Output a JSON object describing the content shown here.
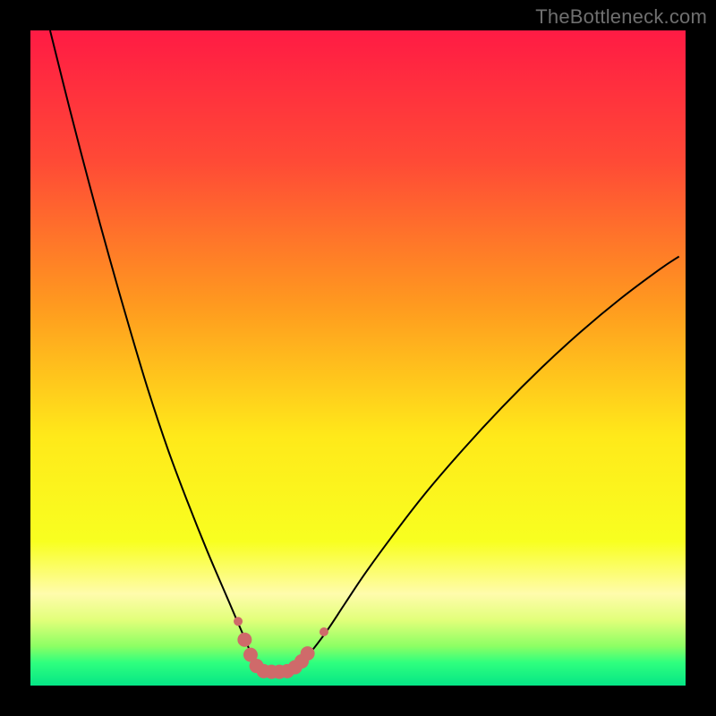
{
  "watermark": "TheBottleneck.com",
  "chart_data": {
    "type": "line",
    "title": "",
    "xlabel": "",
    "ylabel": "",
    "xlim": [
      0,
      100
    ],
    "ylim": [
      0,
      100
    ],
    "background_gradient": {
      "stops": [
        {
          "pos": 0.0,
          "color": "#ff1b44"
        },
        {
          "pos": 0.2,
          "color": "#ff4a36"
        },
        {
          "pos": 0.42,
          "color": "#ff9a1f"
        },
        {
          "pos": 0.62,
          "color": "#ffe91a"
        },
        {
          "pos": 0.78,
          "color": "#f8ff20"
        },
        {
          "pos": 0.86,
          "color": "#fffcac"
        },
        {
          "pos": 0.9,
          "color": "#e2ff7a"
        },
        {
          "pos": 0.94,
          "color": "#8cff64"
        },
        {
          "pos": 0.965,
          "color": "#2fff7e"
        },
        {
          "pos": 1.0,
          "color": "#05e686"
        }
      ]
    },
    "series": [
      {
        "name": "bottleneck-curve",
        "color": "#000000",
        "width": 2,
        "x": [
          3,
          6,
          9,
          12,
          15,
          18,
          21,
          24,
          27,
          30,
          31.5,
          33,
          34,
          34.8,
          36,
          38,
          40,
          42,
          45,
          48,
          51,
          55,
          60,
          66,
          72,
          78,
          84,
          90,
          96,
          99
        ],
        "y": [
          100,
          88,
          76.5,
          65.5,
          55,
          45,
          36,
          28,
          20.5,
          13.5,
          10,
          6.5,
          4,
          2.3,
          2.1,
          2.1,
          2.5,
          4.2,
          8,
          12.5,
          17,
          22.5,
          29,
          36,
          42.5,
          48.5,
          54,
          59,
          63.5,
          65.5
        ]
      }
    ],
    "markers": {
      "color": "#cf6a6a",
      "radius_small": 5,
      "radius_large": 8,
      "points": [
        {
          "x": 31.7,
          "y": 9.8,
          "r": "small"
        },
        {
          "x": 32.7,
          "y": 7.0,
          "r": "large"
        },
        {
          "x": 33.6,
          "y": 4.7,
          "r": "large"
        },
        {
          "x": 34.5,
          "y": 3.0,
          "r": "large"
        },
        {
          "x": 35.6,
          "y": 2.2,
          "r": "large"
        },
        {
          "x": 36.8,
          "y": 2.1,
          "r": "large"
        },
        {
          "x": 38.0,
          "y": 2.1,
          "r": "large"
        },
        {
          "x": 39.2,
          "y": 2.2,
          "r": "large"
        },
        {
          "x": 40.4,
          "y": 2.8,
          "r": "large"
        },
        {
          "x": 41.4,
          "y": 3.7,
          "r": "large"
        },
        {
          "x": 42.3,
          "y": 4.9,
          "r": "large"
        },
        {
          "x": 44.8,
          "y": 8.2,
          "r": "small"
        }
      ]
    }
  }
}
